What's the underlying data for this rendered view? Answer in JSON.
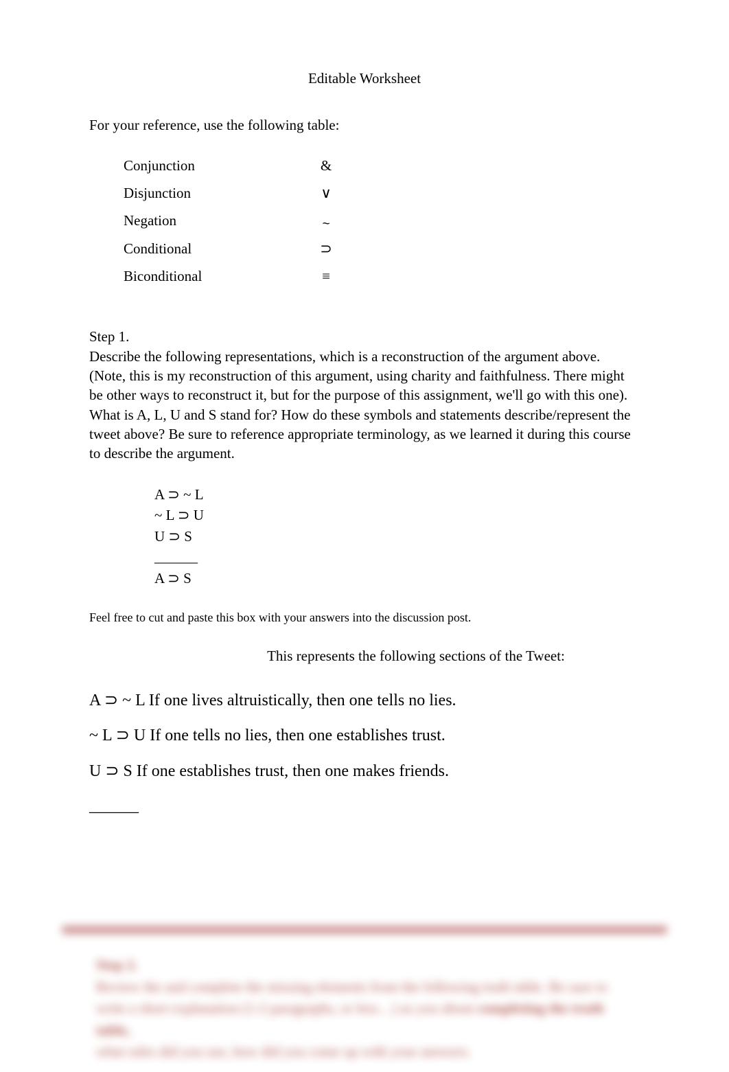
{
  "title": "Editable Worksheet",
  "intro": "For your reference, use the following table:",
  "operators": [
    {
      "name": "Conjunction",
      "symbol": "&"
    },
    {
      "name": "Disjunction",
      "symbol": "∨"
    },
    {
      "name": "Negation",
      "symbol": "~"
    },
    {
      "name": "Conditional",
      "symbol": "⊃"
    },
    {
      "name": "Biconditional",
      "symbol": "≡"
    }
  ],
  "step1": {
    "heading": "Step 1.",
    "body": "Describe the following representations, which is a reconstruction of the argument above. (Note, this is my reconstruction of this argument, using charity and faithfulness. There might be other ways to reconstruct it, but for the purpose of this assignment, we'll go with this one). What is A, L, U and S stand for? How do these symbols and statements describe/represent the tweet above?   Be sure to reference appropriate terminology, as we learned it during this course to describe the argument."
  },
  "argument": {
    "p1": "A  ⊃ ~ L",
    "p2": "~ L  ⊃ U",
    "p3": "U  ⊃ S",
    "divider": "______",
    "c": "A  ⊃ S"
  },
  "note": "Feel free to cut and paste this box with your answers into the discussion post.",
  "represents": "This represents the following sections of the Tweet:",
  "statements": {
    "s1": {
      "prefix": "A   ⊃ ~ L ",
      "text": "If one lives altruistically, then one tells no lies."
    },
    "s2": {
      "prefix": "~ L  ⊃ U ",
      "text": "If one tells no lies, then one establishes trust."
    },
    "s3": {
      "prefix": "U  ⊃ S ",
      "text": "If one establishes trust, then one makes friends."
    },
    "divider": "______"
  },
  "blurred": {
    "heading": "Step 2.",
    "line1": "Review the and complete the missing elements from the following truth table. Be sure to",
    "line2a": "write a short explanation (1-2 paragraphs, or less…) as you about ",
    "line2b": "completing the truth table,",
    "line3": "what rules did you use, how did you come up with your answers."
  }
}
